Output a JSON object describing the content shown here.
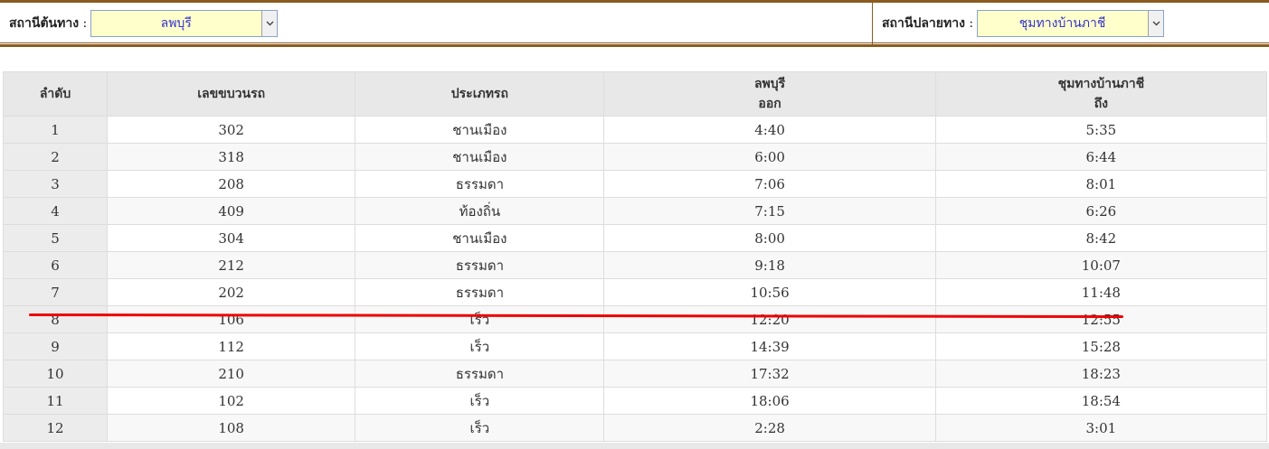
{
  "origin": {
    "label": "สถานีต้นทาง",
    "colon": " :",
    "value": "ลพบุรี"
  },
  "destination": {
    "label": "สถานีปลายทาง",
    "colon": " :",
    "value": "ชุมทางบ้านภาชี"
  },
  "table": {
    "headers": {
      "index": "ลำดับ",
      "train_no": "เลขขบวนรถ",
      "train_type": "ประเภทรถ",
      "origin_station": "ลพบุรี",
      "depart": "ออก",
      "dest_station": "ชุมทางบ้านภาชี",
      "arrive": "ถึง"
    },
    "rows": [
      {
        "index": "1",
        "train_no": "302",
        "type": "ชานเมือง",
        "depart": "4:40",
        "arrive": "5:35"
      },
      {
        "index": "2",
        "train_no": "318",
        "type": "ชานเมือง",
        "depart": "6:00",
        "arrive": "6:44"
      },
      {
        "index": "3",
        "train_no": "208",
        "type": "ธรรมดา",
        "depart": "7:06",
        "arrive": "8:01"
      },
      {
        "index": "4",
        "train_no": "409",
        "type": "ท้องถิ่น",
        "depart": "7:15",
        "arrive": "6:26"
      },
      {
        "index": "5",
        "train_no": "304",
        "type": "ชานเมือง",
        "depart": "8:00",
        "arrive": "8:42"
      },
      {
        "index": "6",
        "train_no": "212",
        "type": "ธรรมดา",
        "depart": "9:18",
        "arrive": "10:07"
      },
      {
        "index": "7",
        "train_no": "202",
        "type": "ธรรมดา",
        "depart": "10:56",
        "arrive": "11:48"
      },
      {
        "index": "8",
        "train_no": "106",
        "type": "เร็ว",
        "depart": "12:20",
        "arrive": "12:55"
      },
      {
        "index": "9",
        "train_no": "112",
        "type": "เร็ว",
        "depart": "14:39",
        "arrive": "15:28"
      },
      {
        "index": "10",
        "train_no": "210",
        "type": "ธรรมดา",
        "depart": "17:32",
        "arrive": "18:23"
      },
      {
        "index": "11",
        "train_no": "102",
        "type": "เร็ว",
        "depart": "18:06",
        "arrive": "18:54"
      },
      {
        "index": "12",
        "train_no": "108",
        "type": "เร็ว",
        "depart": "2:28",
        "arrive": "3:01"
      }
    ]
  },
  "colors": {
    "accent_border": "#8a5a1e",
    "select_bg": "#ffffcc",
    "select_text": "#3333cc",
    "strike": "#ee0000"
  }
}
